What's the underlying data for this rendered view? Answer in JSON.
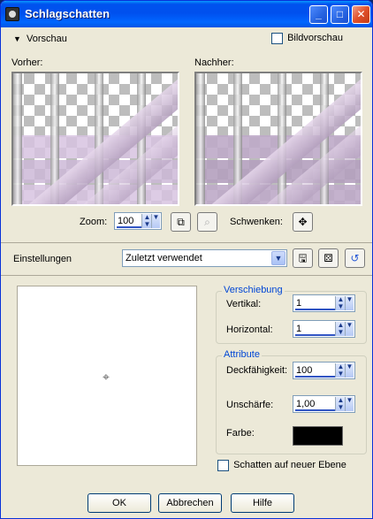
{
  "window": {
    "title": "Schlagschatten"
  },
  "title_buttons": {
    "minimize": "_",
    "maximize": "□",
    "close": "✕"
  },
  "preview_section": {
    "toggle_label": "Vorschau",
    "bild_preview_label": "Bildvorschau",
    "before_label": "Vorher:",
    "after_label": "Nachher:"
  },
  "zoom": {
    "label": "Zoom:",
    "value": "100"
  },
  "pan": {
    "label": "Schwenken:"
  },
  "settings": {
    "label": "Einstellungen",
    "preset_value": "Zuletzt verwendet"
  },
  "offset_group": {
    "title": "Verschiebung",
    "vertical_label": "Vertikal:",
    "vertical_value": "1",
    "horizontal_label": "Horizontal:",
    "horizontal_value": "1"
  },
  "attribute_group": {
    "title": "Attribute",
    "opacity_label": "Deckfähigkeit:",
    "opacity_value": "100",
    "blur_label": "Unschärfe:",
    "blur_value": "1,00",
    "color_label": "Farbe:",
    "color_hex": "#000000"
  },
  "new_layer_label": "Schatten auf neuer Ebene",
  "buttons": {
    "ok": "OK",
    "cancel": "Abbrechen",
    "help": "Hilfe"
  }
}
